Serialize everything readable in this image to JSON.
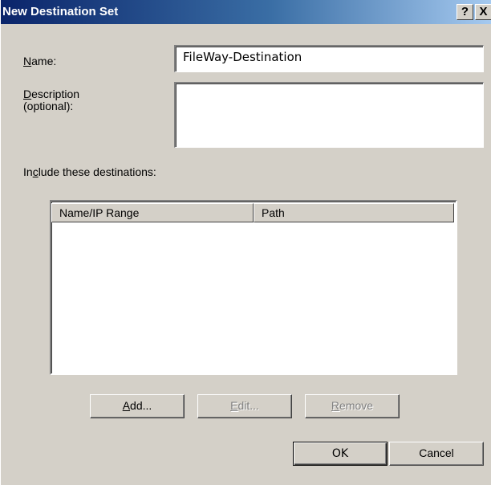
{
  "window": {
    "title": "New Destination Set",
    "help_label": "?",
    "close_label": "X"
  },
  "form": {
    "name_label_acc": "N",
    "name_label_rest": "ame:",
    "name_value": "FileWay-Destination",
    "description_label_acc": "D",
    "description_label_rest": "escription",
    "description_label_line2": "(optional):",
    "description_value": "",
    "include_label_pre": "In",
    "include_label_acc": "c",
    "include_label_rest": "lude these destinations:"
  },
  "list": {
    "columns": [
      "Name/IP Range",
      "Path"
    ],
    "rows": []
  },
  "buttons": {
    "add_acc": "A",
    "add_rest": "dd...",
    "edit_acc": "E",
    "edit_rest": "dit...",
    "remove_acc": "R",
    "remove_rest": "emove",
    "ok": "OK",
    "cancel": "Cancel"
  },
  "colors": {
    "title_start": "#0a246a",
    "title_end": "#a6caf0",
    "face": "#d4d0c8"
  }
}
